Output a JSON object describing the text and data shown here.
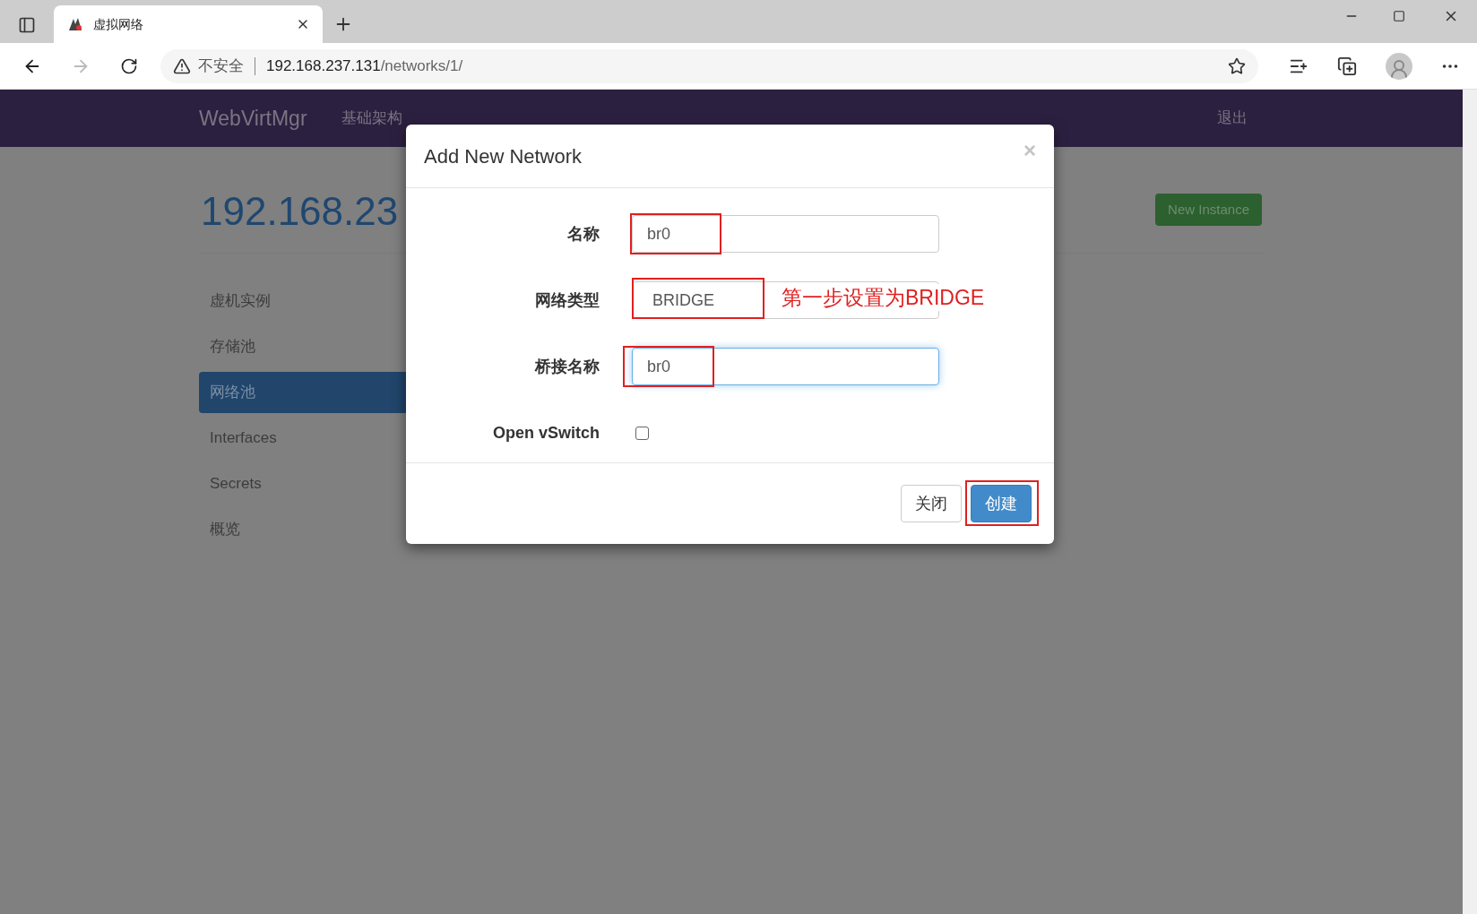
{
  "browser": {
    "tab_title": "虚拟网络",
    "address": {
      "security": "不安全",
      "host": "192.168.237.131",
      "path": "/networks/1/"
    }
  },
  "navbar": {
    "brand": "WebVirtMgr",
    "links": [
      "基础架构"
    ],
    "logout": "退出"
  },
  "page": {
    "heading": "192.168.23",
    "new_instance": "New Instance",
    "sidebar": [
      {
        "label": "虚机实例",
        "selected": false
      },
      {
        "label": "存储池",
        "selected": false
      },
      {
        "label": "网络池",
        "selected": true
      },
      {
        "label": "Interfaces",
        "selected": false
      },
      {
        "label": "Secrets",
        "selected": false
      },
      {
        "label": "概览",
        "selected": false
      }
    ]
  },
  "modal": {
    "title": "Add New Network",
    "close": "×",
    "fields": [
      {
        "kind": "text",
        "label": "名称",
        "value": "br0",
        "focused": false,
        "highlighted": true
      },
      {
        "kind": "select",
        "label": "网络类型",
        "value": "BRIDGE",
        "highlighted": true,
        "annotation": "第一步设置为BRIDGE"
      },
      {
        "kind": "text",
        "label": "桥接名称",
        "value": "br0",
        "focused": true,
        "highlighted": true
      },
      {
        "kind": "checkbox",
        "label": "Open vSwitch",
        "checked": false
      }
    ],
    "buttons": [
      {
        "kind": "default",
        "label": "关闭"
      },
      {
        "kind": "primary",
        "label": "创建",
        "highlighted": true
      }
    ]
  }
}
